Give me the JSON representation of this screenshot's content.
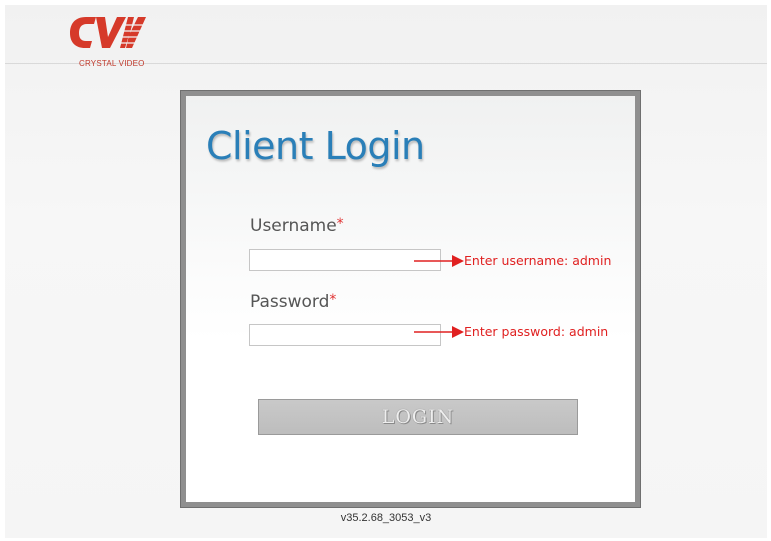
{
  "header": {
    "logo_text": "CRYSTAL VIDEO"
  },
  "login": {
    "title": "Client Login",
    "username_label": "Username",
    "password_label": "Password",
    "required_mark": "*",
    "username_value": "",
    "password_value": "",
    "username_hint": "Enter username: admin",
    "password_hint": "Enter password: admin",
    "button_label": "LOGIN"
  },
  "footer": {
    "version": "v35.2.68_3053_v3"
  },
  "colors": {
    "accent": "#2a7fb8",
    "hint": "#e02020",
    "brand": "#d63a2a"
  }
}
